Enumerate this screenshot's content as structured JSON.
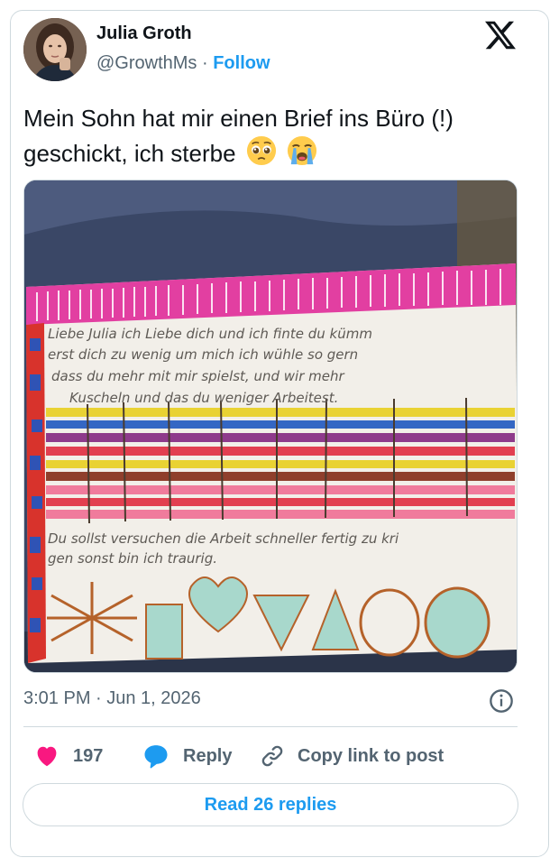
{
  "author": {
    "display_name": "Julia Groth",
    "handle": "@GrowthMs",
    "follow_label": "Follow"
  },
  "tweet": {
    "text_line1": "Mein Sohn hat mir einen Brief ins Büro (!)",
    "text_line2": "geschickt, ich sterbe",
    "emojis": [
      "pleading-face",
      "loudly-crying-face"
    ],
    "timestamp": "3:01 PM · Jun 1, 2026"
  },
  "letter": {
    "lines": [
      "Liebe Julia ich Liebe dich und ich finte du kümm",
      "erst dich zu wenig um mich ich wühle so gern",
      "dass du mehr mit mir spielst, und wir mehr",
      "Kuscheln und das du weniger Arbeitest.",
      "Du sollst versuchen die Arbeit schneller fertig zu kri",
      "gen sonst bin ich traurig."
    ]
  },
  "actions": {
    "like_count": "197",
    "reply_label": "Reply",
    "copy_label": "Copy link to post"
  },
  "replies_button": "Read 26 replies",
  "colors": {
    "accent": "#1d9bf0",
    "like": "#f91880",
    "muted": "#536471",
    "border": "#cfd9de"
  }
}
